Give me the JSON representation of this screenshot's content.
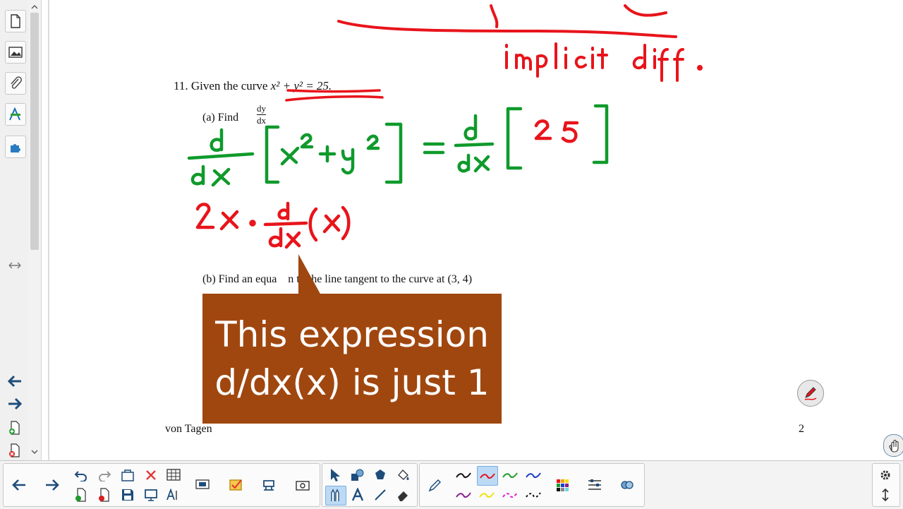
{
  "document": {
    "problem_number": "11.",
    "problem_text": "Given the curve",
    "equation": "x² + y² = 25.",
    "part_a_label": "(a) Find",
    "part_a_numerator": "dy",
    "part_a_denominator": "dx",
    "part_b_text": "(b) Find an equa    n to the line tangent to the curve at (3, 4)",
    "footer_left": "von Tagen",
    "footer_right": "2"
  },
  "handwriting": {
    "note_top": "implicit diff.",
    "line1": "d/dx [x² + y²] = d/dx [25]",
    "line2": "2x · d/dx (x)"
  },
  "callout": {
    "line1": "This expression",
    "line2": "d/dx(x) is just 1"
  },
  "colors": {
    "red_ink": "#e8141b",
    "green_ink": "#0f9a2b",
    "callout_bg": "#a0470f",
    "nav_arrow": "#1f4d7a"
  },
  "icons": {
    "sidebar": [
      "page-icon",
      "image-icon",
      "attachment-icon",
      "properties-icon",
      "addons-icon",
      "resize-icon"
    ],
    "toolbar": [
      "back-icon",
      "forward-icon",
      "undo-icon",
      "redo-icon",
      "delete-icon",
      "table-icon",
      "add-page-icon",
      "delete-page-icon",
      "save-icon",
      "display-icon",
      "handwriting-icon",
      "screen-shade-icon",
      "response-icon",
      "document-camera-icon",
      "capture-icon",
      "select-icon",
      "shapes-icon",
      "fill-icon",
      "pens-icon",
      "text-icon",
      "line-icon",
      "eraser-icon",
      "pen-icon",
      "color-palette-icon",
      "properties-icon",
      "measurement-icon",
      "settings-icon",
      "collapse-icon"
    ]
  }
}
